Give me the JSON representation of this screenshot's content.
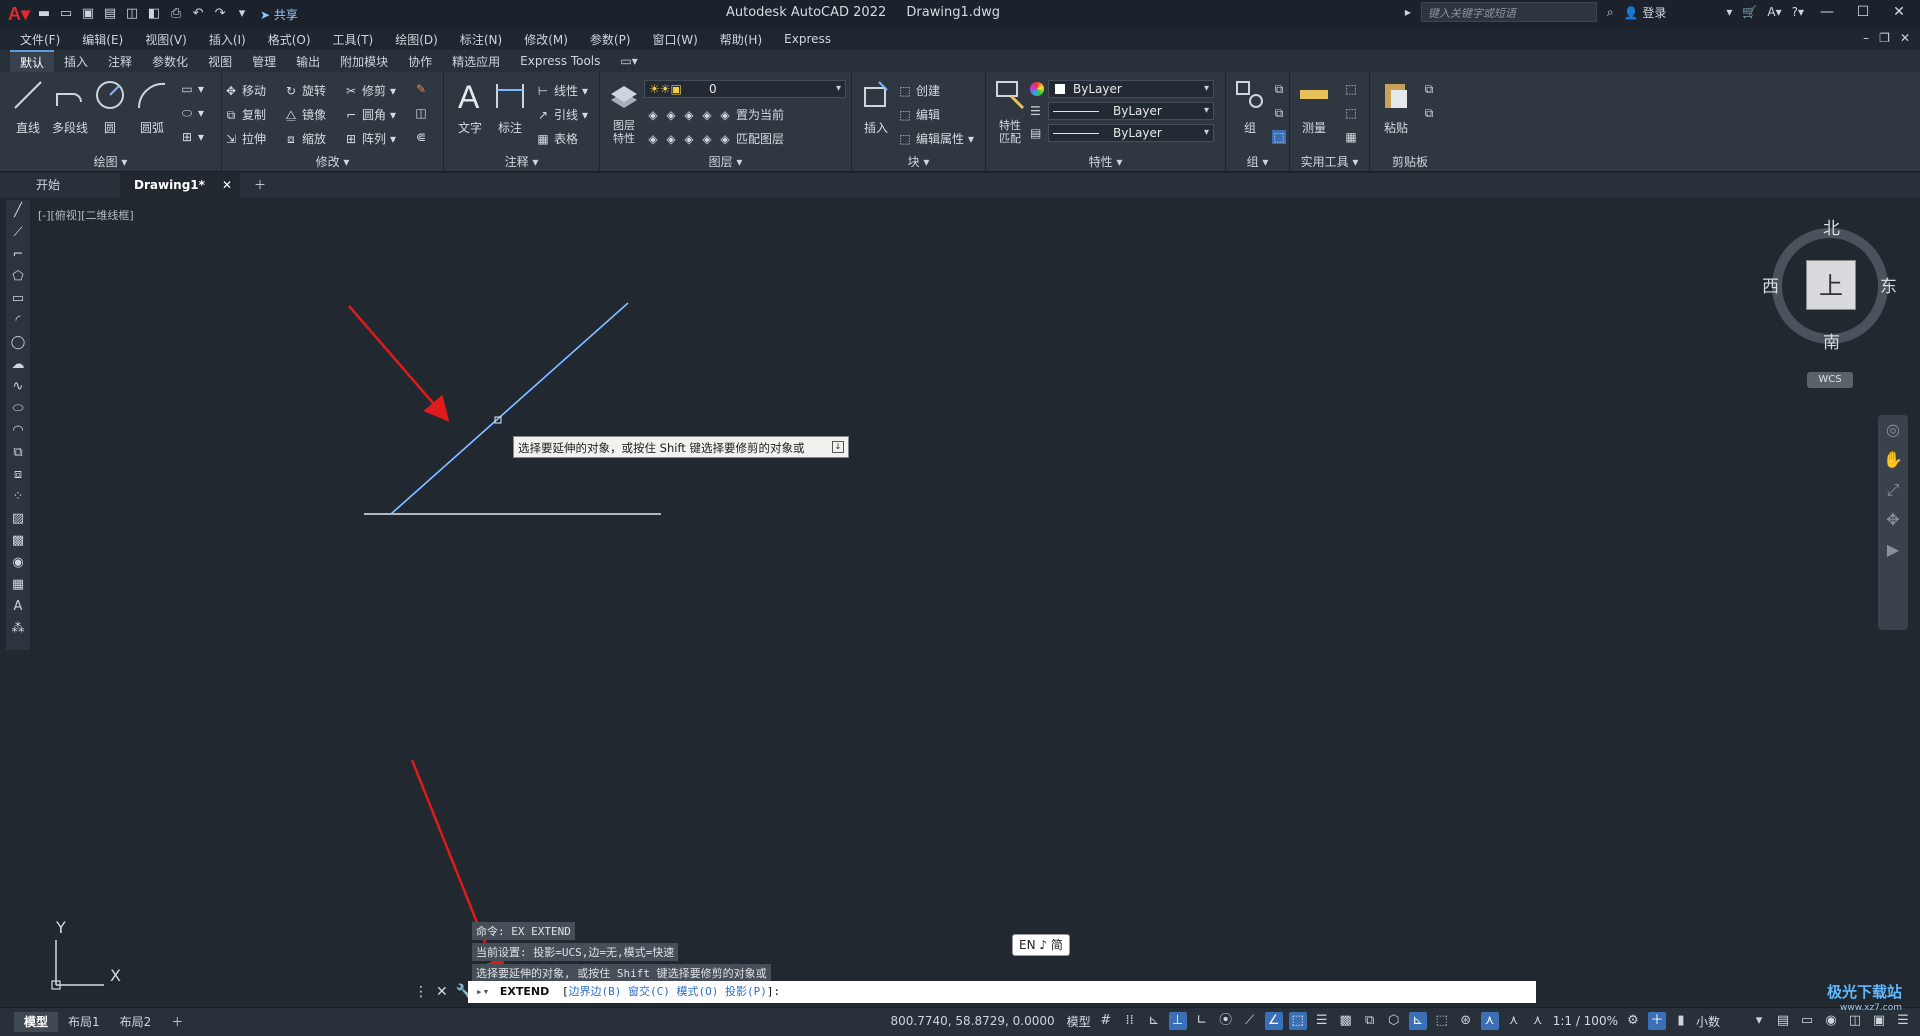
{
  "titlebar": {
    "app_name": "Autodesk AutoCAD 2022",
    "file_name": "Drawing1.dwg",
    "share_label": "共享",
    "search_placeholder": "键入关键字或短语",
    "login_label": "登录"
  },
  "menu": [
    "文件(F)",
    "编辑(E)",
    "视图(V)",
    "插入(I)",
    "格式(O)",
    "工具(T)",
    "绘图(D)",
    "标注(N)",
    "修改(M)",
    "参数(P)",
    "窗口(W)",
    "帮助(H)",
    "Express"
  ],
  "ribbon_tabs": [
    "默认",
    "插入",
    "注释",
    "参数化",
    "视图",
    "管理",
    "输出",
    "附加模块",
    "协作",
    "精选应用",
    "Express Tools"
  ],
  "ribbon": {
    "draw": {
      "title": "绘图",
      "line": "直线",
      "polyline": "多段线",
      "circle": "圆",
      "arc": "圆弧"
    },
    "modify": {
      "title": "修改",
      "move": "移动",
      "rotate": "旋转",
      "trim": "修剪",
      "copy": "复制",
      "mirror": "镜像",
      "fillet": "圆角",
      "stretch": "拉伸",
      "scale": "缩放",
      "array": "阵列"
    },
    "annotation": {
      "title": "注释",
      "text": "文字",
      "dimension": "标注",
      "linear": "线性",
      "leader": "引线",
      "table": "表格"
    },
    "layers": {
      "title": "图层",
      "layer_props": "图层\n特性",
      "layer_value": "0",
      "make_current": "置为当前",
      "match_layer": "匹配图层"
    },
    "block": {
      "title": "块",
      "insert": "插入",
      "create": "创建",
      "edit": "编辑",
      "edit_attr": "编辑属性"
    },
    "properties": {
      "title": "特性",
      "match": "特性\n匹配",
      "color": "ByLayer",
      "linetype": "ByLayer",
      "lineweight": "ByLayer"
    },
    "groups": {
      "title": "组",
      "group": "组"
    },
    "utilities": {
      "title": "实用工具",
      "measure": "测量"
    },
    "clipboard": {
      "title": "剪贴板",
      "paste": "粘贴"
    }
  },
  "file_tabs": {
    "start": "开始",
    "drawing": "Drawing1*"
  },
  "viewport_label": "[-][俯视][二维线框]",
  "tooltip": "选择要延伸的对象，或按住 Shift 键选择要修剪的对象或",
  "viewcube": {
    "north": "北",
    "south": "南",
    "east": "东",
    "west": "西",
    "face": "上",
    "wcs": "WCS"
  },
  "ucs": {
    "x": "X",
    "y": "Y"
  },
  "command_history": [
    "命令: EX EXTEND",
    "当前设置: 投影=UCS,边=无,模式=快速",
    "选择要延伸的对象, 或按住 Shift 键选择要修剪的对象或"
  ],
  "command_line": {
    "command": "EXTEND",
    "prefix": "[",
    "opt1": "边界边(B)",
    "opt2": "窗交(C)",
    "opt3": "模式(O)",
    "opt4": "投影(P)",
    "suffix": "]:"
  },
  "ime": "EN ♪ 简",
  "status": {
    "layout_tabs": [
      "模型",
      "布局1",
      "布局2"
    ],
    "coords": "800.7740, 58.8729, 0.0000",
    "model_label": "模型",
    "scale": "1:1 / 100%",
    "units": "小数"
  },
  "watermark": {
    "title": "极光下载站",
    "url": "www.xz7.com"
  },
  "colors": {
    "accent": "#3b6fb6",
    "line_selected": "#5aa0ff",
    "arrow": "#e01b1b"
  }
}
